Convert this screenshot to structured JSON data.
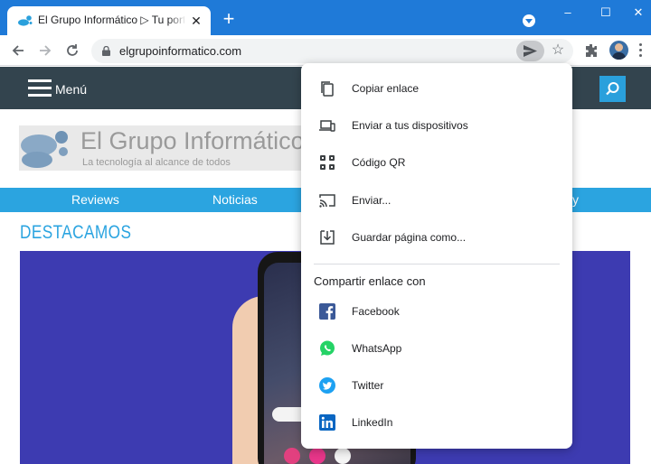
{
  "browser": {
    "tab_title": "El Grupo Informático ▷ Tu portal",
    "new_tab_label": "+",
    "close_tab_label": "✕",
    "url": "elgrupoinformatico.com",
    "window_controls": {
      "minimize": "–",
      "maximize": "☐",
      "close": "✕"
    },
    "icons": [
      "back-icon",
      "forward-icon",
      "reload-icon",
      "lock-icon",
      "share-icon",
      "bookmark-star-icon",
      "extensions-icon",
      "profile-avatar",
      "more-menu-icon",
      "tab-search-icon"
    ]
  },
  "site": {
    "menu_label": "Menú",
    "logo": {
      "name": "El Grupo Informático",
      "tagline": "La tecnología al alcance de todos"
    },
    "categories": [
      "Reviews",
      "Noticias",
      "y"
    ],
    "section_title": "DESTACAMOS",
    "colors": {
      "header": "#33444e",
      "accent": "#2ba4e0",
      "hero": "#3d3bb1"
    }
  },
  "share_menu": {
    "items": [
      {
        "label": "Copiar enlace",
        "icon": "copy-icon"
      },
      {
        "label": "Enviar a tus dispositivos",
        "icon": "devices-icon"
      },
      {
        "label": "Código QR",
        "icon": "qr-code-icon"
      },
      {
        "label": "Enviar...",
        "icon": "cast-icon"
      },
      {
        "label": "Guardar página como...",
        "icon": "save-page-icon"
      }
    ],
    "share_with_heading": "Compartir enlace con",
    "targets": [
      {
        "label": "Facebook",
        "icon": "facebook-icon",
        "color": "#3b5998"
      },
      {
        "label": "WhatsApp",
        "icon": "whatsapp-icon",
        "color": "#25d366"
      },
      {
        "label": "Twitter",
        "icon": "twitter-icon",
        "color": "#1da1f2"
      },
      {
        "label": "LinkedIn",
        "icon": "linkedin-icon",
        "color": "#0a66c2"
      }
    ]
  }
}
